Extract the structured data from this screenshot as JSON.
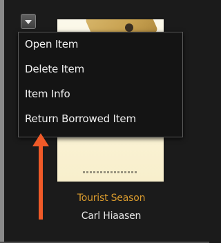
{
  "menu": {
    "items": [
      {
        "label": "Open Item"
      },
      {
        "label": "Delete Item"
      },
      {
        "label": "Item Info"
      },
      {
        "label": "Return Borrowed Item"
      }
    ],
    "toggle_icon": "chevron-down-icon"
  },
  "book": {
    "title": "Tourist Season",
    "author": "Carl Hiaasen"
  },
  "colors": {
    "background": "#1b1b1b",
    "title": "#d89a2d",
    "author": "#e6e6e6",
    "menu_text": "#f0f0f0",
    "arrow": "#f05a28"
  },
  "annotation": {
    "icon": "arrow-up-icon"
  }
}
